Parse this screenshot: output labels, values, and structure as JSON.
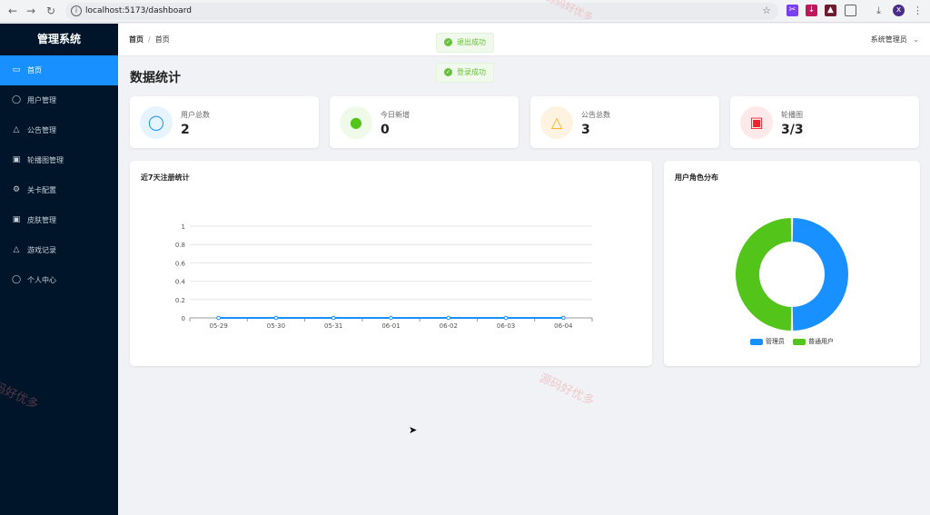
{
  "browser": {
    "url": "localhost:5173/dashboard",
    "profile_initial": "x"
  },
  "sidebar": {
    "title": "管理系统",
    "items": [
      {
        "label": "首页",
        "icon": "home-icon",
        "active": true
      },
      {
        "label": "用户管理",
        "icon": "user-icon"
      },
      {
        "label": "公告管理",
        "icon": "bell-icon"
      },
      {
        "label": "轮播图管理",
        "icon": "picture-icon"
      },
      {
        "label": "关卡配置",
        "icon": "gear-icon"
      },
      {
        "label": "皮肤管理",
        "icon": "picture-icon"
      },
      {
        "label": "游戏记录",
        "icon": "bell-icon"
      },
      {
        "label": "个人中心",
        "icon": "user-icon"
      }
    ]
  },
  "header": {
    "breadcrumb": [
      "首页",
      "首页"
    ],
    "separator": "/",
    "user_name": "系统管理员"
  },
  "toasts": [
    "退出成功",
    "登录成功"
  ],
  "page_title": "数据统计",
  "stats": [
    {
      "label": "用户总数",
      "value": "2",
      "icon": "user-outline-icon",
      "color": "#1890ff",
      "bg": "#e6f4ff"
    },
    {
      "label": "今日新增",
      "value": "0",
      "icon": "user-filled-icon",
      "color": "#52c41a",
      "bg": "#f0fae8"
    },
    {
      "label": "公告总数",
      "value": "3",
      "icon": "bell-icon",
      "color": "#faad14",
      "bg": "#fdf3e0"
    },
    {
      "label": "轮播图",
      "value": "3/3",
      "icon": "picture-icon",
      "color": "#f5222d",
      "bg": "#fde9ea"
    }
  ],
  "watermark": "源码好优多",
  "colors": {
    "sidebar_bg": "#001529",
    "accent": "#1890ff",
    "green": "#52c41a"
  },
  "chart_data": [
    {
      "type": "line",
      "title": "近7天注册统计",
      "categories": [
        "05-29",
        "05-30",
        "05-31",
        "06-01",
        "06-02",
        "06-03",
        "06-04"
      ],
      "series": [
        {
          "values": [
            0,
            0,
            0,
            0,
            0,
            0,
            0
          ]
        }
      ],
      "ylim": [
        0,
        1
      ],
      "yticks": [
        "0",
        "0.2",
        "0.4",
        "0.6",
        "0.8",
        "1"
      ],
      "grid": true,
      "color": "#1890ff"
    },
    {
      "type": "pie",
      "title": "用户角色分布",
      "labels": [
        "管理员",
        "普通用户"
      ],
      "values": [
        1,
        1
      ],
      "colors": [
        "#1890ff",
        "#52c41a"
      ],
      "legend": "bottom"
    }
  ]
}
